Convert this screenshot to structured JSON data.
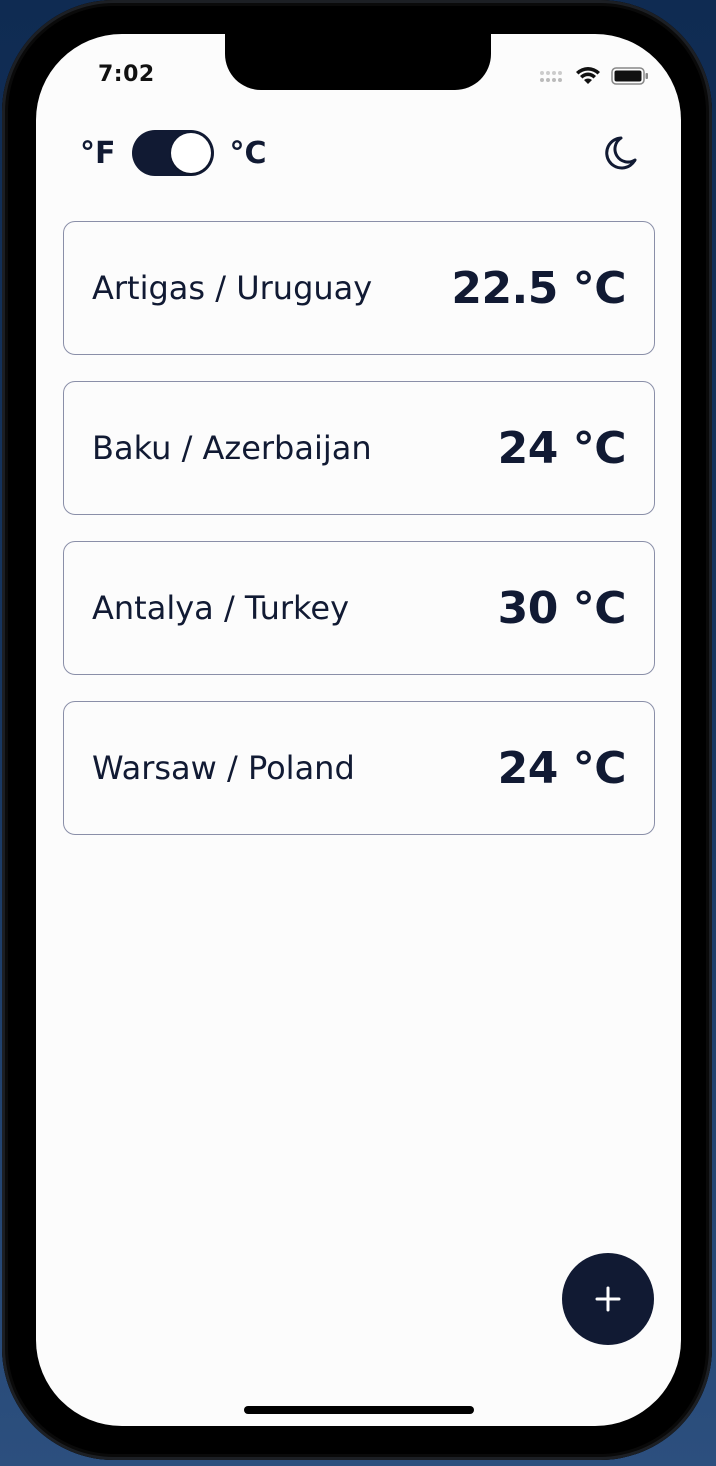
{
  "status_bar": {
    "time": "7:02"
  },
  "header": {
    "fahrenheit_label": "°F",
    "celsius_label": "°C",
    "unit_toggle_on": true,
    "theme_icon": "moon-icon"
  },
  "cities": [
    {
      "name": "Artigas / Uruguay",
      "temp": "22.5 °C"
    },
    {
      "name": "Baku / Azerbaijan",
      "temp": "24 °C"
    },
    {
      "name": "Antalya / Turkey",
      "temp": "30 °C"
    },
    {
      "name": "Warsaw / Poland",
      "temp": "24 °C"
    }
  ],
  "fab": {
    "icon": "plus-icon"
  },
  "colors": {
    "primary": "#111a33",
    "background": "#fcfcfc",
    "card_border": "#8a8fa8"
  }
}
